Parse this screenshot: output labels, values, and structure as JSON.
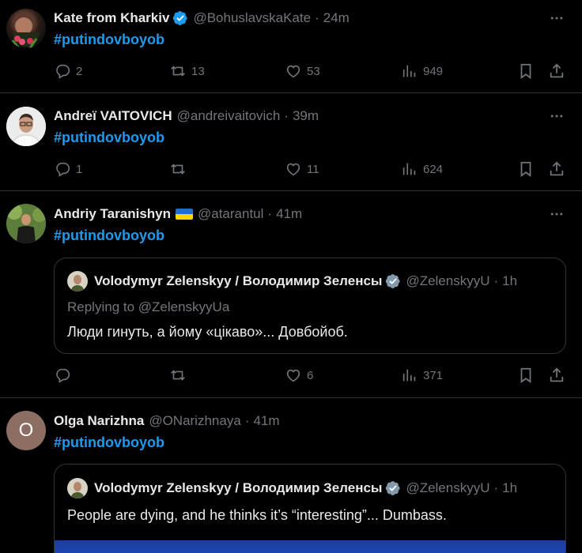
{
  "colors": {
    "background": "#000000",
    "accent": "#1d9bf0",
    "muted": "#71767b",
    "text": "#e7e9ea",
    "border": "#2f3336"
  },
  "tweets": [
    {
      "name": "Kate from Kharkiv",
      "handle": "@BohuslavskaKate",
      "dot": "·",
      "time": "24m",
      "verified": true,
      "hashtag": "#putindovboyob",
      "stats": {
        "replies": "2",
        "retweets": "13",
        "likes": "53",
        "views": "949"
      }
    },
    {
      "name": "Andreї VAITOVICH",
      "handle": "@andreivaitovich",
      "dot": "·",
      "time": "39m",
      "hashtag": "#putindovboyob",
      "stats": {
        "replies": "1",
        "retweets": "",
        "likes": "11",
        "views": "624"
      }
    },
    {
      "name": "Andriy Taranishyn",
      "handle": "@atarantul",
      "dot": "·",
      "time": "41m",
      "flag": "ukraine-flag",
      "hashtag": "#putindovboyob",
      "quote": {
        "name": "Volodymyr Zelenskyy / Володимир Зеленсы",
        "handle": "@ZelenskyyU",
        "dot": "·",
        "time": "1h",
        "replying": "Replying to @ZelenskyyUa",
        "text": "Люди гинуть, а йому «цікаво»... Довбойоб."
      },
      "stats": {
        "replies": "",
        "retweets": "",
        "likes": "6",
        "views": "371"
      }
    },
    {
      "name": "Olga Narizhna",
      "handle": "@ONarizhnaya",
      "dot": "·",
      "time": "41m",
      "avatar_letter": "O",
      "hashtag": "#putindovboyob",
      "quote": {
        "name": "Volodymyr Zelenskyy / Володимир Зеленсы",
        "handle": "@ZelenskyyU",
        "dot": "·",
        "time": "1h",
        "text": "People are dying, and he thinks it’s “interesting”... Dumbass."
      }
    }
  ]
}
